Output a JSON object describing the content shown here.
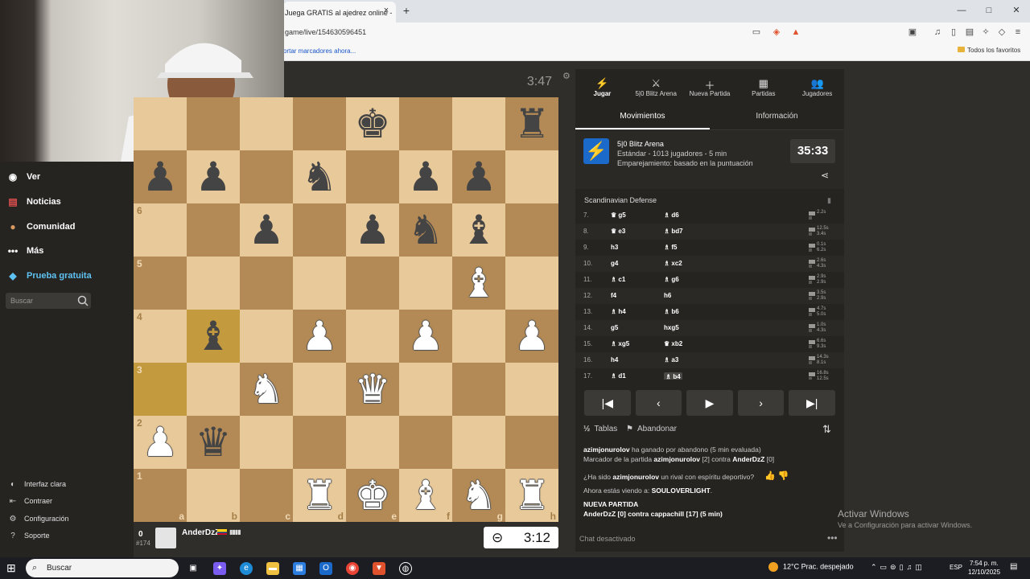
{
  "browser": {
    "tab_title": "Juega GRATIS al ajedrez online -",
    "tab_close": "×",
    "new_tab": "+",
    "address": "game/live/154630596451",
    "bookmark_import": "ortar marcadores ahora...",
    "bookmark_favs": "Todos los favoritos",
    "win_min": "—",
    "win_max": "□",
    "win_close": "✕"
  },
  "leftnav": {
    "items": [
      {
        "label": "Ver",
        "icon": "binoculars-icon"
      },
      {
        "label": "Noticias",
        "icon": "news-icon"
      },
      {
        "label": "Comunidad",
        "icon": "community-icon"
      },
      {
        "label": "Más",
        "icon": "more-dots-icon"
      },
      {
        "label": "Prueba gratuita",
        "icon": "diamond-icon"
      }
    ],
    "search_placeholder": "Buscar",
    "footer": [
      {
        "label": "Interfaz clara",
        "icon": "contrast-icon"
      },
      {
        "label": "Contraer",
        "icon": "collapse-icon"
      },
      {
        "label": "Configuración",
        "icon": "gear-icon"
      },
      {
        "label": "Soporte",
        "icon": "help-icon"
      }
    ]
  },
  "board": {
    "opponent_clock": "3:47",
    "ranks": [
      "6",
      "5",
      "4",
      "3",
      "2",
      "1"
    ],
    "files": [
      "a",
      "b",
      "c",
      "d",
      "e",
      "f",
      "g",
      "h"
    ]
  },
  "player": {
    "score": "0",
    "rank": "#174",
    "name": "AnderDzZ",
    "bars": "▮▮▮▮",
    "clock": "3:12",
    "clock_icon": "⊝"
  },
  "right": {
    "topnav": [
      {
        "label": "Jugar",
        "icon": "⚡"
      },
      {
        "label": "5|0 Blitz Arena",
        "icon": "⚔"
      },
      {
        "label": "Nueva Partida",
        "icon": "＋"
      },
      {
        "label": "Partidas",
        "icon": "▦"
      },
      {
        "label": "Jugadores",
        "icon": "👥"
      }
    ],
    "subtabs": [
      "Movimientos",
      "Información"
    ],
    "arena": {
      "title": "5|0 Blitz Arena",
      "line2": "Estándar - 1013 jugadores - 5 min",
      "line3": "Emparejamiento: basado en la puntuación",
      "time": "35:33"
    },
    "opening": "Scandinavian Defense",
    "moves": [
      {
        "n": "7.",
        "w": "♛ g5",
        "b": "♗ d6",
        "t1": "2.2s",
        "t2": ""
      },
      {
        "n": "8.",
        "w": "♛ e3",
        "b": "♗ bd7",
        "t1": "12.5s",
        "t2": "3.4s"
      },
      {
        "n": "9.",
        "w": "h3",
        "b": "♗ f5",
        "t1": "0.1s",
        "t2": "6.2s"
      },
      {
        "n": "10.",
        "w": "g4",
        "b": "♗ xc2",
        "t1": "2.6s",
        "t2": "4.3s"
      },
      {
        "n": "11.",
        "w": "♗ c1",
        "b": "♗ g6",
        "t1": "2.9s",
        "t2": "2.9s"
      },
      {
        "n": "12.",
        "w": "f4",
        "b": "h6",
        "t1": "3.5s",
        "t2": "2.9s"
      },
      {
        "n": "13.",
        "w": "♗ h4",
        "b": "♗ b6",
        "t1": "4.7s",
        "t2": "5.0s"
      },
      {
        "n": "14.",
        "w": "g5",
        "b": "hxg5",
        "t1": "1.0s",
        "t2": "4.3s"
      },
      {
        "n": "15.",
        "w": "♗ xg5",
        "b": "♛ xb2",
        "t1": "6.6s",
        "t2": "9.3s"
      },
      {
        "n": "16.",
        "w": "h4",
        "b": "♗ a3",
        "t1": "14.3s",
        "t2": "8.1s"
      },
      {
        "n": "17.",
        "w": "♗ d1",
        "b": "♗ b4",
        "t1": "16.8s",
        "t2": "12.5s"
      }
    ],
    "controls": [
      "⏮",
      "◀",
      "▶",
      "▶",
      "⏭"
    ],
    "draw": "Tablas",
    "resign": "Abandonar",
    "chat": {
      "l1a": "azimjonurolov",
      "l1b": " ha ganado por abandono (5 min evaluada)",
      "l2a": "Marcador de la partida ",
      "l2b": "azimjonurolov",
      "l2c": " [2] contra ",
      "l2d": "AnderDzZ",
      "l2e": " [0]",
      "l3a": "¿Ha sido ",
      "l3b": "azimjonurolov",
      "l3c": " un rival con espíritu deportivo?",
      "l4a": "Ahora estás viendo a: ",
      "l4b": "SOULOVERLIGHT",
      "l4c": ".",
      "l5": "NUEVA PARTIDA",
      "l6": "AnderDzZ [0] contra cappachill [17] (5 min)",
      "disabled": "Chat desactivado",
      "more": "•••"
    }
  },
  "windows": {
    "activate1": "Activar Windows",
    "activate2": "Ve a Configuración para activar Windows."
  },
  "taskbar": {
    "search": "Buscar",
    "weather": "12°C  Prac. despejado",
    "lang": "ESP",
    "time": "7:54 p. m.",
    "date": "12/10/2025"
  }
}
